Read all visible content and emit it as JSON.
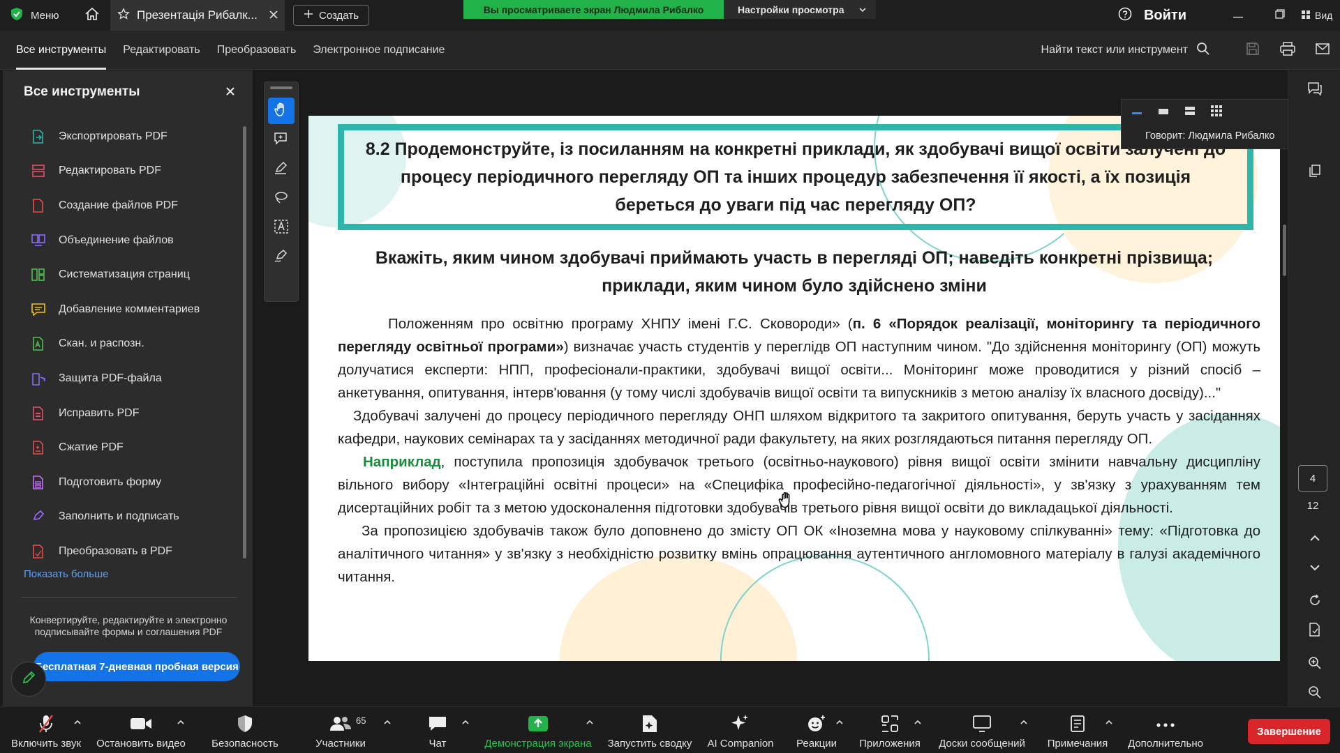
{
  "titlebar": {
    "menu_label": "Меню",
    "tab_title": "Презентація Рибалк...",
    "create_label": "Создать",
    "share_notice": "Вы просматриваете экран Людмила Рибалко",
    "view_settings": "Настройки просмотра",
    "login_label": "Войти",
    "view_label": "Вид"
  },
  "toolbar": {
    "tabs": [
      {
        "label": "Все инструменты"
      },
      {
        "label": "Редактировать"
      },
      {
        "label": "Преобразовать"
      },
      {
        "label": "Электронное подписание"
      }
    ],
    "search_label": "Найти текст или инструмент"
  },
  "left_panel": {
    "title": "Все инструменты",
    "items": [
      {
        "label": "Экспортировать PDF",
        "icon": "export-pdf-icon",
        "color": "#2fb5aa"
      },
      {
        "label": "Редактировать PDF",
        "icon": "edit-pdf-icon",
        "color": "#e8506e"
      },
      {
        "label": "Создание файлов PDF",
        "icon": "create-pdf-icon",
        "color": "#e84a4a"
      },
      {
        "label": "Объединение файлов",
        "icon": "combine-files-icon",
        "color": "#8a6cff"
      },
      {
        "label": "Систематизация страниц",
        "icon": "organize-pages-icon",
        "color": "#4cc24c"
      },
      {
        "label": "Добавление комментариев",
        "icon": "comment-icon",
        "color": "#f0c020"
      },
      {
        "label": "Скан. и распозн.",
        "icon": "scan-icon",
        "color": "#4cc24c"
      },
      {
        "label": "Защита PDF-файла",
        "icon": "protect-icon",
        "color": "#8a6cff"
      },
      {
        "label": "Исправить PDF",
        "icon": "redact-icon",
        "color": "#e8506e"
      },
      {
        "label": "Сжатие PDF",
        "icon": "compress-icon",
        "color": "#e84a4a"
      },
      {
        "label": "Подготовить форму",
        "icon": "prepare-form-icon",
        "color": "#c86cff"
      },
      {
        "label": "Заполнить и подписать",
        "icon": "fill-sign-icon",
        "color": "#a06cff"
      },
      {
        "label": "Преобразовать в PDF",
        "icon": "convert-pdf-icon",
        "color": "#e84a4a"
      }
    ],
    "show_more": "Показать больше",
    "promo_text": "Конвертируйте, редактируйте и электронно подписывайте формы и соглашения PDF",
    "trial_button": "Бесплатная 7-дневная пробная версия"
  },
  "document": {
    "header_question": "8.2 Продемонструйте, із посиланням на конкретні приклади, як здобувачі вищої освіти залучені до процесу періодичного перегляду ОП та інших процедур забезпечення її якості, а їх позиція береться до уваги під час перегляду ОП?",
    "subheading": "Вкажіть, яким чином здобувачі приймають участь в перегляді ОП; наведіть конкретні прізвища; приклади, яким чином було здійснено зміни",
    "p1_a": "Положенням про освітню програму ХНПУ імені Г.С. Сковороди» (",
    "p1_bold": "п. 6 «Порядок реалізації, моніторингу та періодичного перегляду освітньої програми»",
    "p1_b": ") визначає участь студентів у переглідв ОП наступним чином. \"До здійснення моніторингу (ОП) можуть долучатися експерти: НПП, професіонали-практики, здобувачі вищої освіти... Моніторинг може проводитися у різний спосіб – анкетування, опитування, інтерв'ювання (у тому числі здобувачів вищої освіти та випускників з метою аналізу їх власного досвіду)...\"",
    "p2": "Здобувачі залучені до процесу періодичного перегляду ОНП шляхом відкритого та закритого опитування, беруть участь у засіданнях кафедри, наукових семінарах та у засіданнях методичної ради факультету, на яких розглядаються питання перегляду ОП.",
    "p3_bold": "Наприклад",
    "p3": ", поступила пропозиція здобувачок третього (освітньо-наукового) рівня вищої освіти змінити навчальну дисципліну вільного вибору «Інтеграційні освітні процеси» на «Специфіка професійно-педагогічної діяльності», у зв'язку з урахуванням тем дисертаційних робіт та з метою удосконалення підготовки здобувачів третього рівня вищої освіти до викладацької діяльності.",
    "p4": "За пропозицією здобувачів також було доповнено до змісту ОП ОК «Іноземна мова у науковому спілкуванні» тему: «Підготовка до аналітичного читання» у зв'язку з необхідністю розвитку вмінь опрацювання аутентичного англомовного матеріалу в галузі академічного читання."
  },
  "speaker": {
    "label": "Говорит: Людмила Рибалко"
  },
  "pager": {
    "current": "4",
    "total": "12"
  },
  "meeting_bar": {
    "mute": "Включить звук",
    "video": "Остановить видео",
    "security": "Безопасность",
    "participants": "Участники",
    "participants_count": "65",
    "chat": "Чат",
    "share": "Демонстрация экрана",
    "summary": "Запустить сводку",
    "ai": "AI Companion",
    "reactions": "Реакции",
    "apps": "Приложения",
    "whiteboards": "Доски сообщений",
    "notes": "Примечания",
    "more": "Дополнительно",
    "end": "Завершение"
  },
  "colors": {
    "accent_teal": "#2fb5aa",
    "share_green": "#21b24a",
    "end_red": "#d9262a",
    "acrobat_blue": "#1473e6"
  }
}
